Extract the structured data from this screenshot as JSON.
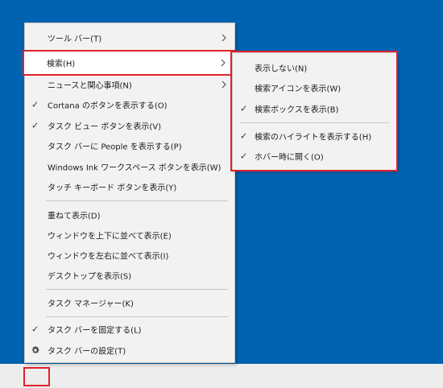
{
  "main_menu": {
    "items": [
      {
        "label": "ツール バー(T)",
        "checked": false,
        "submenu": true
      },
      {
        "label": "検索(H)",
        "checked": false,
        "submenu": true,
        "highlighted": true
      },
      {
        "label": "ニュースと関心事項(N)",
        "checked": false,
        "submenu": true
      },
      {
        "label": "Cortana のボタンを表示する(O)",
        "checked": true,
        "submenu": false
      },
      {
        "label": "タスク ビュー ボタンを表示(V)",
        "checked": true,
        "submenu": false
      },
      {
        "label": "タスク バーに People を表示する(P)",
        "checked": false,
        "submenu": false
      },
      {
        "label": "Windows Ink ワークスペース ボタンを表示(W)",
        "checked": false,
        "submenu": false
      },
      {
        "label": "タッチ キーボード ボタンを表示(Y)",
        "checked": false,
        "submenu": false
      },
      {
        "label": "重ねて表示(D)",
        "checked": false,
        "submenu": false
      },
      {
        "label": "ウィンドウを上下に並べて表示(E)",
        "checked": false,
        "submenu": false
      },
      {
        "label": "ウィンドウを左右に並べて表示(I)",
        "checked": false,
        "submenu": false
      },
      {
        "label": "デスクトップを表示(S)",
        "checked": false,
        "submenu": false
      },
      {
        "label": "タスク マネージャー(K)",
        "checked": false,
        "submenu": false
      },
      {
        "label": "タスク バーを固定する(L)",
        "checked": true,
        "submenu": false
      },
      {
        "label": "タスク バーの設定(T)",
        "checked": false,
        "submenu": false,
        "icon": "gear-icon"
      }
    ]
  },
  "search_submenu": {
    "items": [
      {
        "label": "表示しない(N)",
        "checked": false
      },
      {
        "label": "検索アイコンを表示(W)",
        "checked": false
      },
      {
        "label": "検索ボックスを表示(B)",
        "checked": true
      },
      {
        "label": "検索のハイライトを表示する(H)",
        "checked": true
      },
      {
        "label": "ホバー時に開く(O)",
        "checked": true
      }
    ]
  },
  "glyphs": {
    "check": "✓"
  },
  "colors": {
    "desktop": "#0063b1",
    "menu_bg": "#f2f2f2",
    "highlight_border": "#e0202c",
    "taskbar": "#ededed"
  }
}
